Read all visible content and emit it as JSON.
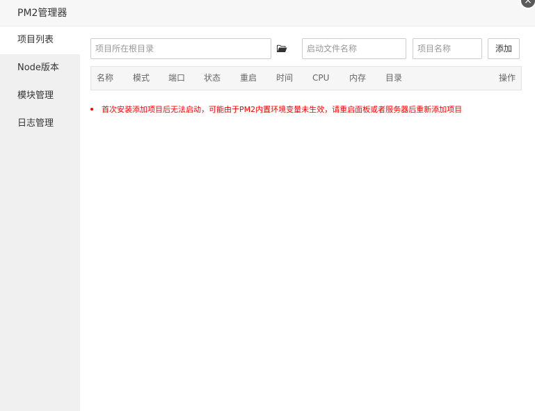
{
  "window": {
    "title": "PM2管理器",
    "close_glyph": "×"
  },
  "sidebar": {
    "items": [
      {
        "label": "项目列表",
        "active": true
      },
      {
        "label": "Node版本",
        "active": false
      },
      {
        "label": "模块管理",
        "active": false
      },
      {
        "label": "日志管理",
        "active": false
      }
    ]
  },
  "form": {
    "project_root_placeholder": "项目所在根目录",
    "startup_file_placeholder": "启动文件名称",
    "project_name_placeholder": "项目名称",
    "add_label": "添加",
    "folder_icon": "folder-open-icon"
  },
  "table": {
    "columns": [
      "名称",
      "模式",
      "端口",
      "状态",
      "重启",
      "时间",
      "CPU",
      "内存",
      "目录",
      "操作"
    ]
  },
  "notice": {
    "text": "首次安装添加项目后无法启动，可能由于PM2内置环境变量未生效，请重启面板或者服务器后重新添加项目"
  }
}
